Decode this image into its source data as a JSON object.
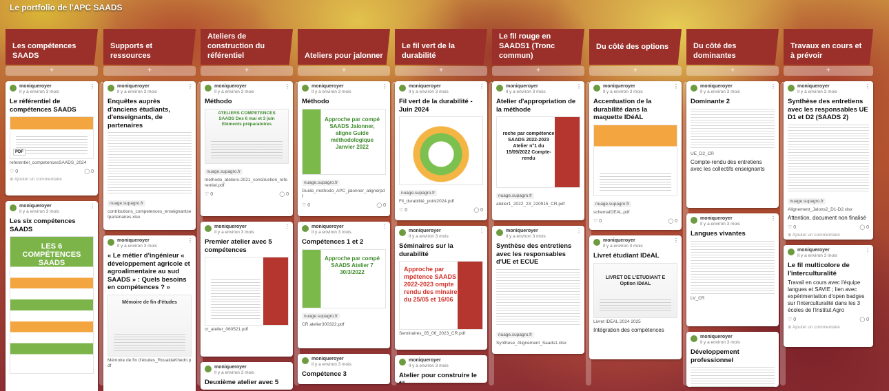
{
  "board": {
    "title": "Le portfolio de l'APC SAADS"
  },
  "common": {
    "author": "moniqueroyer",
    "time": "Il y a environ 3 mois",
    "add_comment": "Ajouter un commentaire",
    "likes": "0",
    "comments": "0",
    "add_post": "+"
  },
  "columns": [
    {
      "title": "Les compétences SAADS",
      "cards": [
        {
          "title": "Le référentiel de compétences SAADS",
          "file": "referentiel_competencesSAADS_2024"
        },
        {
          "title": "Les six compétences SAADS",
          "thumb_text": "LES 6 COMPÉTENCES SAADS"
        }
      ]
    },
    {
      "title": "Supports et ressources",
      "cards": [
        {
          "title": "Enquêtes auprès d'anciens étudiants, d'enseignants, de partenaires",
          "domain": "nuage.supagro.fr",
          "file": "contributions_competences_enseignantsetpartenaires.xlsx"
        },
        {
          "title": "« Le métier d'ingénieur « développement agricole et agroalimentaire au sud SAADS » : Quels besoins en compétences ? »",
          "thumb_text": "Mémoire de fin d'études",
          "file": "Mémoire de fin d'études_RouaidaKhedri.pdf"
        }
      ]
    },
    {
      "title": "Ateliers de construction du référentiel",
      "cards": [
        {
          "title": "Méthodo",
          "thumb_text": "ATELIERS COMPETENCES SAADS Des 6 mai et 3 juin Eléments préparatoires",
          "domain": "nuage.supagro.fr",
          "file": "methodo_ateliers-2021_construction_referentiel.pdf"
        },
        {
          "title": "Premier atelier avec 5 compétences",
          "file": "cr_atelier_060521.pdf"
        },
        {
          "title": "Deuxième atelier avec 5"
        }
      ]
    },
    {
      "title": "Ateliers pour jalonner",
      "cards": [
        {
          "title": "Méthodo",
          "thumb_text": "Approche par compé SAADS Jalonner, aligne Guide méthodologique Janvier 2022",
          "domain": "nuage.supagro.fr",
          "file": "Guide_methodo_APC_jalonner_alignerpdf"
        },
        {
          "title": "Compétences 1 et 2",
          "thumb_text": "Approche par compé SAADS Atelier 7 30/3/2022",
          "domain": "nuage.supagro.fr",
          "file": "CR atelier300322.pdf"
        },
        {
          "title": "Compétence 3"
        }
      ]
    },
    {
      "title": "Le fil vert de la durabilité",
      "cards": [
        {
          "title": "Fil vert de la durabilité - Juin 2024",
          "domain": "nuage.supagro.fr",
          "file": "Fil_durabilité_point2024.pdf"
        },
        {
          "title": "Séminaires sur la durabilité",
          "thumb_text": "Approche par mpétence SAADS 2022-2023 ompte rendu des minaires du 25/05 et 16/06",
          "file": "Seminaires_05_06_2023_CR.pdf"
        },
        {
          "title": "Atelier pour construire le fil"
        }
      ]
    },
    {
      "title": "Le fil rouge en SAADS1 (Tronc commun)",
      "cards": [
        {
          "title": "Atelier d'appropriation de la méthode",
          "thumb_text": "roche par compétence SAADS 2022-2023 Atelier n°1 du 15/09/2022 Compte-rendu",
          "domain": "nuage.supagro.fr",
          "file": "atelier1_2022_23_220915_CR.pdf"
        },
        {
          "title": "Synthèse des entretiens avec les responsables d'UE et ECUE",
          "domain": "nuage.supagro.fr",
          "file": "Synthese_Alignement_Saads1.xlsx"
        }
      ]
    },
    {
      "title": "Du côté des options",
      "cards": [
        {
          "title": "Accentuation de la durabilité dans la maquette IDéAL",
          "domain": "nuage.supagro.fr",
          "file": "schemaIDEAL.pdf"
        },
        {
          "title": "Livret étudiant IDéAL",
          "thumb_text": "LIVRET DE L'ETUDIANT E Option IDéAL",
          "file": "Livret IDEAL 2024 2025",
          "body": "Intégration des compétences"
        }
      ]
    },
    {
      "title": "Du côté des dominantes",
      "cards": [
        {
          "title": "Dominante 2",
          "file": "UE_D2_CR",
          "body": "Compte-rendu des entretiens avec les collectifs enseignants"
        },
        {
          "title": "Langues vivantes",
          "file": "LV_CR"
        },
        {
          "title": "Développement professionnel"
        }
      ]
    },
    {
      "title": "Travaux en cours et à prévoir",
      "cards": [
        {
          "title": "Synthèse des entretiens avec les responsables UE D1 et D2 (SAADS 2)",
          "domain": "nuage.supagro.fr",
          "file": "Alignement_Jalons2_D1-D2.xlsx",
          "body": "Attention, document non finalisé"
        },
        {
          "title": "Le fil multicolore de l'interculturalité",
          "body": "Travail en cours avec l'équipe langues et SAVIE ; lien avec expérimentation d'open badges sur l'interculturalité dans les 3 écoles de l'Institut Agro"
        }
      ]
    }
  ]
}
